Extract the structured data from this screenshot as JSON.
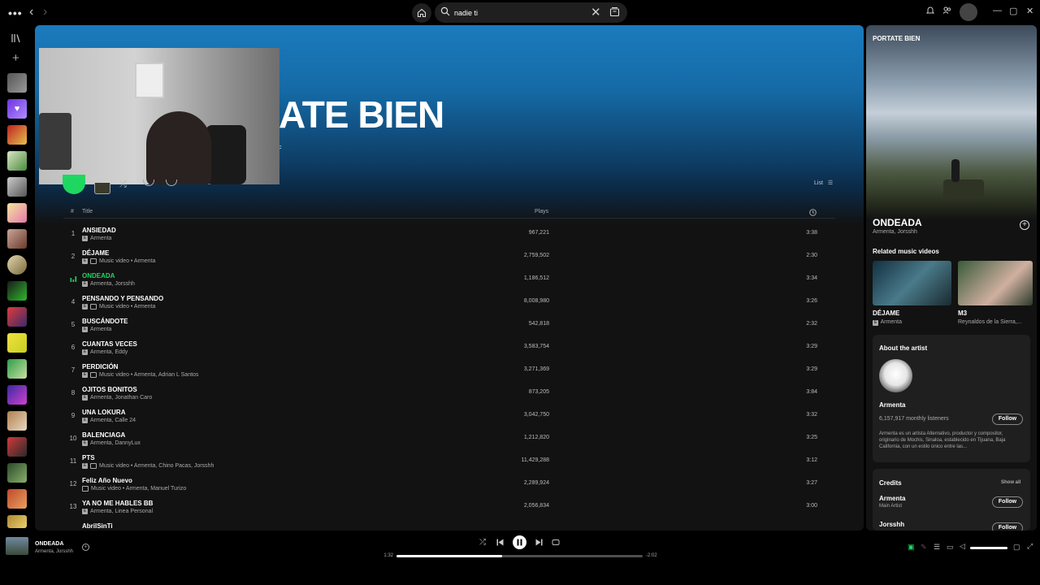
{
  "search": {
    "value": "nadie ti"
  },
  "main": {
    "hero_title": "ATE BIEN",
    "hero_sub": "c",
    "list_toggle": "List",
    "headers": {
      "num": "#",
      "title": "Title",
      "plays": "Plays"
    },
    "tracks": [
      {
        "num": "1",
        "title": "ANSIEDAD",
        "meta": "Armenta",
        "mv": false,
        "explicit": true,
        "plays": "967,221",
        "dur": "3:38"
      },
      {
        "num": "2",
        "title": "DÉJAME",
        "meta": "Music video • Armenta",
        "mv": true,
        "explicit": true,
        "plays": "2,759,502",
        "dur": "2:30"
      },
      {
        "num": "",
        "title": "ONDEADA",
        "meta": "Armenta, Jorsshh",
        "mv": false,
        "explicit": true,
        "plays": "1,186,512",
        "dur": "3:34",
        "active": true
      },
      {
        "num": "4",
        "title": "PENSANDO Y PENSANDO",
        "meta": "Music video • Armenta",
        "mv": true,
        "explicit": true,
        "plays": "8,008,980",
        "dur": "3:26"
      },
      {
        "num": "5",
        "title": "BUSCÁNDOTE",
        "meta": "Armenta",
        "mv": false,
        "explicit": true,
        "plays": "542,818",
        "dur": "2:32"
      },
      {
        "num": "6",
        "title": "CUANTAS VECES",
        "meta": "Armenta, Eddy",
        "mv": false,
        "explicit": true,
        "plays": "3,583,754",
        "dur": "3:29"
      },
      {
        "num": "7",
        "title": "PERDICIÓN",
        "meta": "Music video • Armenta, Adrian L Santos",
        "mv": true,
        "explicit": true,
        "plays": "3,271,369",
        "dur": "3:29"
      },
      {
        "num": "8",
        "title": "OJITOS BONITOS",
        "meta": "Armenta, Jonathan Caro",
        "mv": false,
        "explicit": true,
        "plays": "873,205",
        "dur": "3:84"
      },
      {
        "num": "9",
        "title": "UNA LOKURA",
        "meta": "Armenta, Calle 24",
        "mv": false,
        "explicit": true,
        "plays": "3,042,750",
        "dur": "3:32"
      },
      {
        "num": "10",
        "title": "BALENCIAGA",
        "meta": "Armenta, DannyLux",
        "mv": false,
        "explicit": true,
        "plays": "1,212,820",
        "dur": "3:25"
      },
      {
        "num": "11",
        "title": "PTS",
        "meta": "Music video • Armenta, Chino Pacas, Jorsshh",
        "mv": true,
        "explicit": true,
        "plays": "11,429,288",
        "dur": "3:12"
      },
      {
        "num": "12",
        "title": "Feliz Año Nuevo",
        "meta": "Music video • Armenta, Manuel Turizo",
        "mv": true,
        "explicit": false,
        "plays": "2,289,924",
        "dur": "3:27"
      },
      {
        "num": "13",
        "title": "YA NO ME HABLES BB",
        "meta": "Armenta, Linea Personal",
        "mv": false,
        "explicit": true,
        "plays": "2,056,834",
        "dur": "3:00"
      },
      {
        "num": "",
        "title": "AbrilSinTi",
        "meta": "",
        "mv": false,
        "explicit": false,
        "plays": "",
        "dur": ""
      }
    ]
  },
  "right_panel": {
    "header": "PORTATE BIEN",
    "track_title": "ONDEADA",
    "track_artists": "Armenta, Jorsshh",
    "related_heading": "Related music videos",
    "related": [
      {
        "title": "DÉJAME",
        "artist": "Armenta"
      },
      {
        "title": "M3",
        "artist": "Reynaldos de la Sierra,..."
      }
    ],
    "about_heading": "About the artist",
    "artist_name": "Armenta",
    "listeners": "6,157,917 monthly listeners",
    "follow": "Follow",
    "bio": "Armenta es un artista Alternativo, productor y compositor, originario de Mochis, Sinaloa, establecido en Tijuana, Baja California, con un estilo único entre las...",
    "credits_heading": "Credits",
    "show_all": "Show all",
    "credits": [
      {
        "name": "Armenta",
        "role": "Main Artist"
      },
      {
        "name": "Jorsshh",
        "role": ""
      }
    ]
  },
  "player": {
    "title": "ONDEADA",
    "artists": "Armenta, Jorsshh",
    "elapsed": "1:32",
    "remaining": "-2:02",
    "progress": 0.43,
    "volume": 1.0
  },
  "colors": {
    "accent": "#1ed760",
    "hero_blue": "#1b7bbd"
  }
}
